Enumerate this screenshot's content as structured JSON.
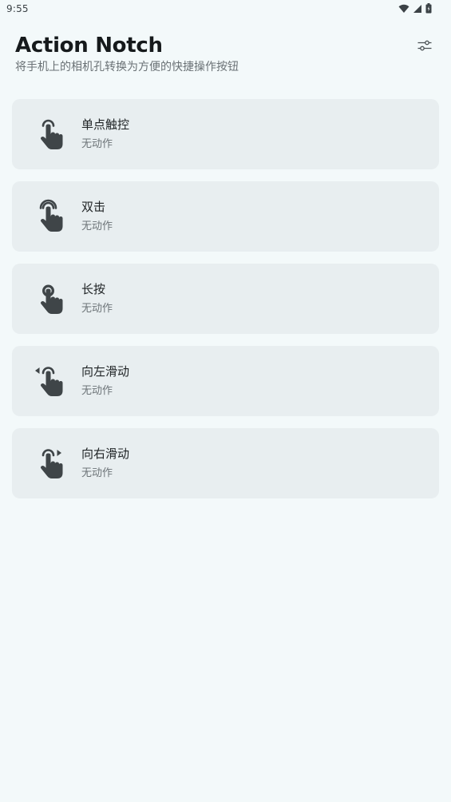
{
  "status_bar": {
    "time": "9:55",
    "icons": [
      "wifi-icon",
      "cellular-signal-icon",
      "battery-icon"
    ]
  },
  "header": {
    "title": "Action Notch",
    "subtitle": "将手机上的相机孔转换为方便的快捷操作按钮",
    "settings_icon": "sliders-icon"
  },
  "actions": [
    {
      "name": "单点触控",
      "value": "无动作",
      "icon": "single-tap-icon"
    },
    {
      "name": "双击",
      "value": "无动作",
      "icon": "double-tap-icon"
    },
    {
      "name": "长按",
      "value": "无动作",
      "icon": "long-press-icon"
    },
    {
      "name": "向左滑动",
      "value": "无动作",
      "icon": "swipe-left-icon"
    },
    {
      "name": "向右滑动",
      "value": "无动作",
      "icon": "swipe-right-icon"
    }
  ],
  "colors": {
    "background": "#f3f9fa",
    "card": "#e8eef0",
    "icon": "#3f4548",
    "title": "#161a1c",
    "secondary_text": "#6d7478"
  }
}
